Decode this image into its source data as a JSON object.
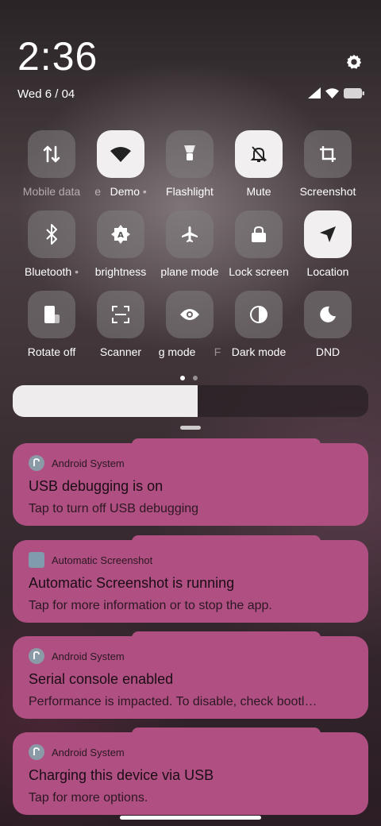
{
  "status": {
    "time": "2:36",
    "date": "Wed 6 / 04"
  },
  "tiles": [
    {
      "label": "Mobile data",
      "icon": "mobile-data-icon",
      "on": false
    },
    {
      "label": "Demo",
      "icon": "wifi-icon",
      "on": true
    },
    {
      "label": "Flashlight",
      "icon": "flashlight-icon",
      "on": false
    },
    {
      "label": "Mute",
      "icon": "bell-off-icon",
      "on": true
    },
    {
      "label": "Screenshot",
      "icon": "crop-icon",
      "on": false
    },
    {
      "label": "Bluetooth",
      "icon": "bluetooth-icon",
      "on": false
    },
    {
      "label": "brightness",
      "icon": "auto-brightness-icon",
      "on": false
    },
    {
      "label": "plane mode",
      "icon": "airplane-icon",
      "on": false
    },
    {
      "label": "Lock screen",
      "icon": "lock-icon",
      "on": false
    },
    {
      "label": "Location",
      "icon": "location-icon",
      "on": true
    },
    {
      "label": "Rotate off",
      "icon": "rotate-icon",
      "on": false
    },
    {
      "label": "Scanner",
      "icon": "scanner-icon",
      "on": false
    },
    {
      "label": "g mode",
      "icon": "eye-icon",
      "on": false
    },
    {
      "label": "Dark mode",
      "icon": "dark-mode-icon",
      "on": false
    },
    {
      "label": "DND",
      "icon": "moon-icon",
      "on": false
    }
  ],
  "brightness_level": 0.52,
  "notifications": [
    {
      "app": "Android System",
      "title": "USB debugging is on",
      "text": "Tap to turn off USB debugging"
    },
    {
      "app": "Automatic Screenshot",
      "title": "Automatic Screenshot is running",
      "text": "Tap for more information or to stop the app."
    },
    {
      "app": "Android System",
      "title": "Serial console enabled",
      "text": "Performance is impacted. To disable, check bootl…"
    },
    {
      "app": "Android System",
      "title": "Charging this device via USB",
      "text": "Tap for more options."
    }
  ],
  "colors": {
    "notification_bg": "#b04f82",
    "tile_on": "#f1eff0",
    "tile_off": "rgba(130,125,128,0.55)"
  }
}
